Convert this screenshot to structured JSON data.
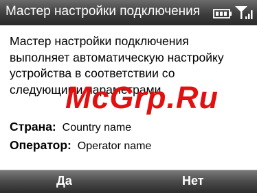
{
  "window": {
    "title": "Мастер настройки подключения"
  },
  "status": {
    "battery_icon": "battery-icon",
    "signal_icon": "signal-icon"
  },
  "main": {
    "message": "Мастер настройки подключения выполняет автоматическую настройку устройства в соответствии со следующими параметрами.",
    "fields": [
      {
        "label": "Страна:",
        "value": "Country name"
      },
      {
        "label": "Оператор:",
        "value": "Operator name"
      }
    ]
  },
  "watermark": {
    "text": "McGrp.Ru"
  },
  "softkeys": {
    "left": "Да",
    "right": "Нет"
  }
}
